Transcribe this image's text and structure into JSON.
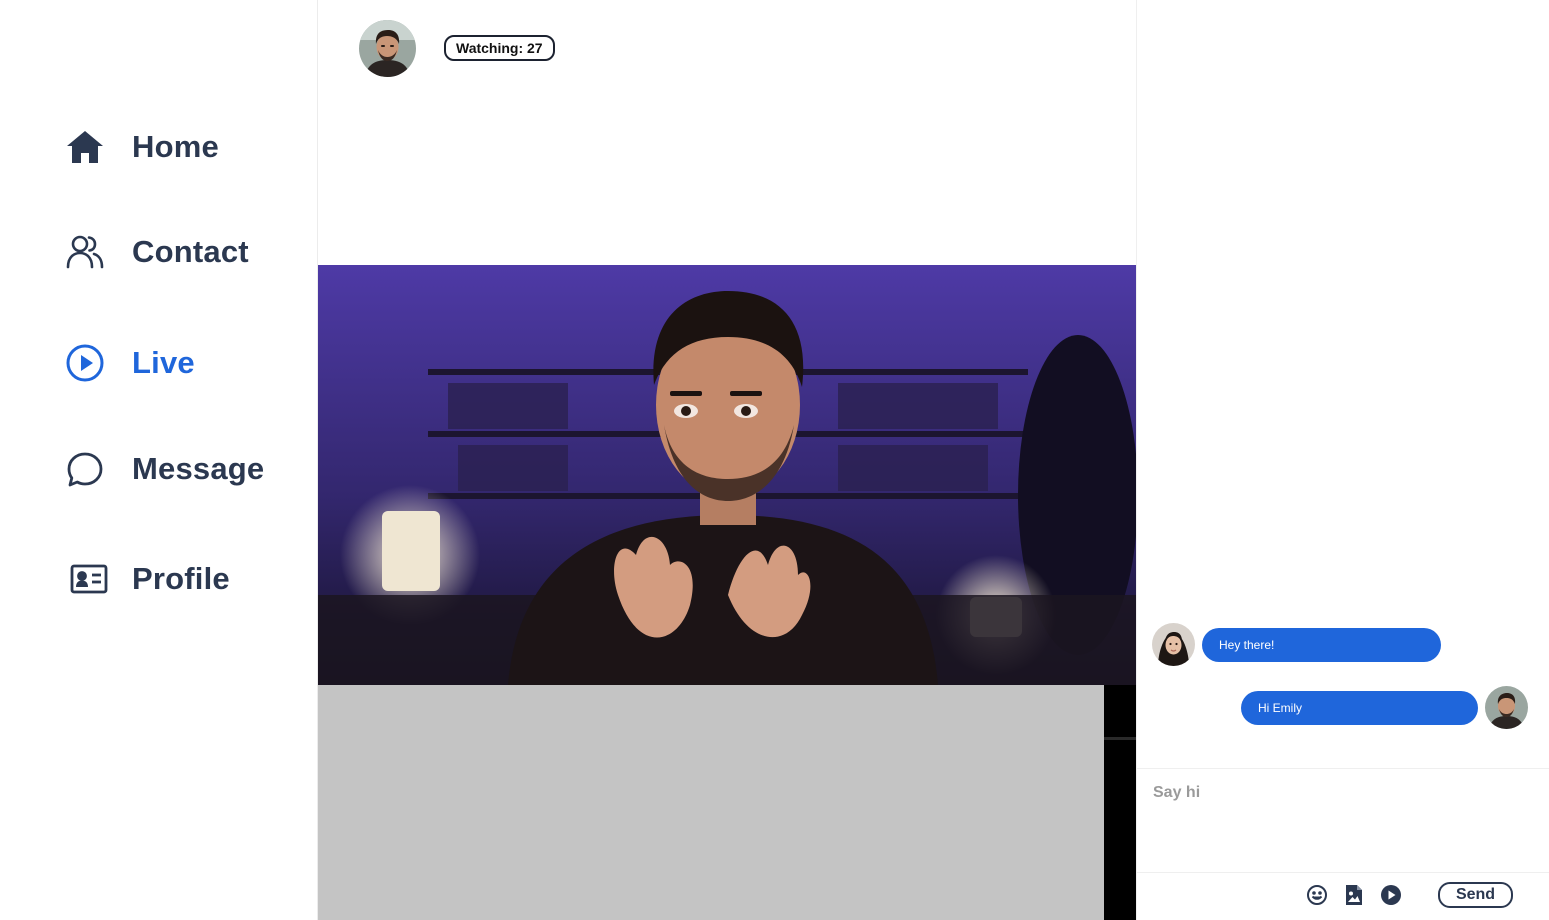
{
  "sidebar": {
    "items": [
      {
        "label": "Home",
        "icon": "home-icon",
        "active": false
      },
      {
        "label": "Contact",
        "icon": "users-icon",
        "active": false
      },
      {
        "label": "Live",
        "icon": "play-circle-icon",
        "active": true
      },
      {
        "label": "Message",
        "icon": "chat-bubble-icon",
        "active": false
      },
      {
        "label": "Profile",
        "icon": "id-card-icon",
        "active": false
      }
    ]
  },
  "stream": {
    "watching_label": "Watching: 27"
  },
  "chat": {
    "messages": [
      {
        "text": "Hey there!",
        "direction": "incoming"
      },
      {
        "text": "Hi Emily",
        "direction": "outgoing"
      }
    ],
    "input_placeholder": "Say hi",
    "send_label": "Send"
  },
  "colors": {
    "accent": "#1f66db",
    "text": "#2b3850"
  }
}
